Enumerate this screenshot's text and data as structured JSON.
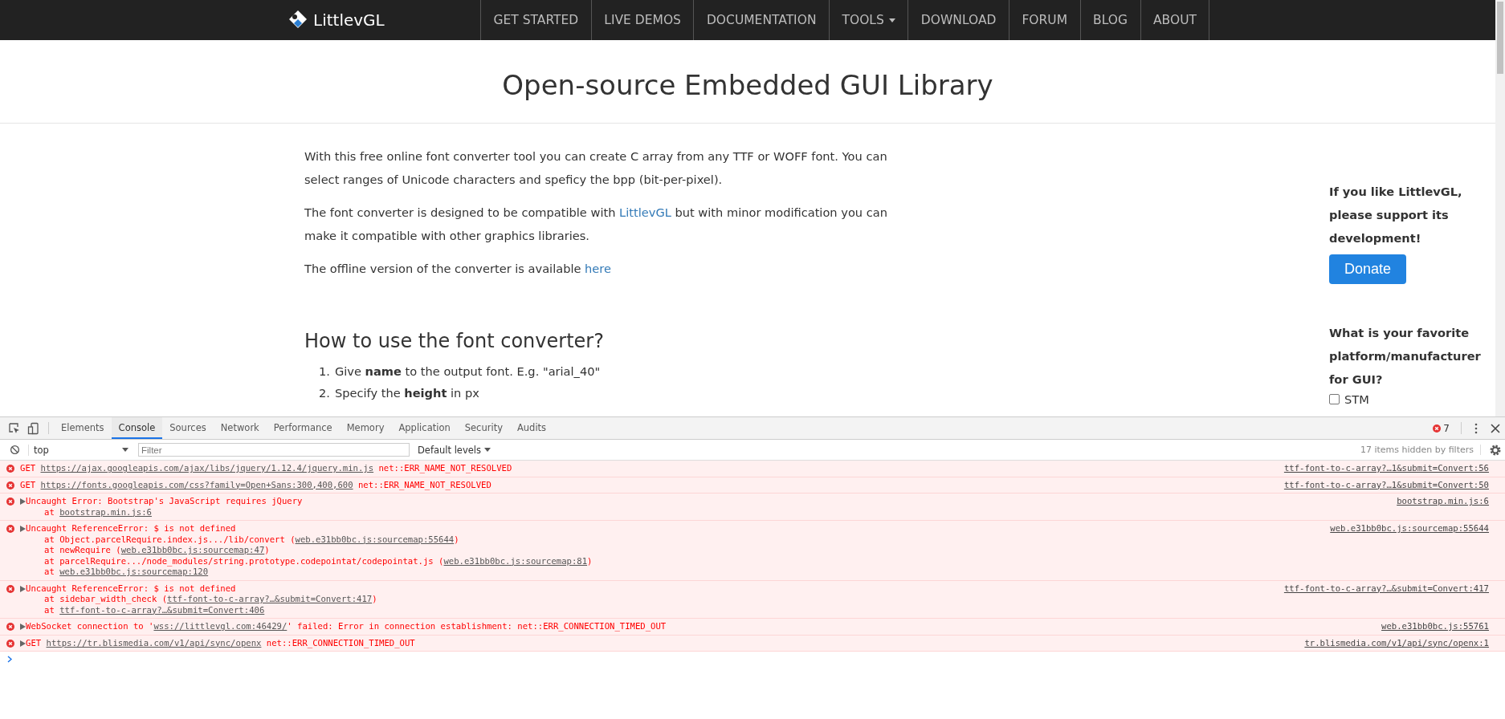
{
  "navbar": {
    "logo": "LittlevGL",
    "items": [
      {
        "label": "GET STARTED",
        "kind": "link"
      },
      {
        "label": "LIVE DEMOS",
        "kind": "link"
      },
      {
        "label": "DOCUMENTATION",
        "kind": "link"
      },
      {
        "label": "TOOLS",
        "kind": "dropdown"
      },
      {
        "label": "DOWNLOAD",
        "kind": "link"
      },
      {
        "label": "FORUM",
        "kind": "link"
      },
      {
        "label": "BLOG",
        "kind": "link"
      },
      {
        "label": "ABOUT",
        "kind": "link"
      }
    ]
  },
  "page": {
    "title": "Open-source Embedded GUI Library",
    "paragraphs": [
      [
        {
          "kind": "text",
          "text": "With this free online font converter tool you can create C array from any TTF or WOFF font. You can select ranges of Unicode characters and speficy the bpp (bit-per-pixel)."
        }
      ],
      [
        {
          "kind": "text",
          "text": "The font converter is designed to be compatible with "
        },
        {
          "kind": "link",
          "text": "LittlevGL"
        },
        {
          "kind": "text",
          "text": " but with minor modification you can make it compatible with other graphics libraries."
        }
      ],
      [
        {
          "kind": "text",
          "text": "The offline version of the converter is available "
        },
        {
          "kind": "link",
          "text": "here"
        }
      ]
    ],
    "section_heading": "How to use the font converter?",
    "steps": [
      {
        "number": "1.",
        "text": "Give **name** to the output font. E.g. \"arial_40\""
      },
      {
        "number": "2.",
        "text": "Specify the **height** in px"
      }
    ]
  },
  "sidebar": {
    "support_text": "If you like LittlevGL, please support its development!",
    "donate_button": "Donate",
    "poll_question": "What is your favorite platform/manufacturer for GUI?",
    "options": [
      {
        "label": "STM",
        "checked": false
      }
    ]
  },
  "devtools": {
    "tabs": [
      {
        "label": "Elements",
        "selected": false
      },
      {
        "label": "Console",
        "selected": true
      },
      {
        "label": "Sources",
        "selected": false
      },
      {
        "label": "Network",
        "selected": false
      },
      {
        "label": "Performance",
        "selected": false
      },
      {
        "label": "Memory",
        "selected": false
      },
      {
        "label": "Application",
        "selected": false
      },
      {
        "label": "Security",
        "selected": false
      },
      {
        "label": "Audits",
        "selected": false
      }
    ],
    "error_count": "7",
    "context": "top",
    "filter_placeholder": "Filter",
    "levels": "Default levels",
    "hidden_note": "17 items hidden by filters",
    "messages": [
      {
        "expandable": false,
        "lines": [
          [
            {
              "kind": "text",
              "text": "GET "
            },
            {
              "kind": "link",
              "text": "https://ajax.googleapis.com/ajax/libs/jquery/1.12.4/jquery.min.js"
            },
            {
              "kind": "text",
              "text": " net::ERR_NAME_NOT_RESOLVED"
            }
          ]
        ],
        "source": "ttf-font-to-c-array?…1&submit=Convert:56"
      },
      {
        "expandable": false,
        "lines": [
          [
            {
              "kind": "text",
              "text": "GET "
            },
            {
              "kind": "link",
              "text": "https://fonts.googleapis.com/css?family=Open+Sans:300,400,600"
            },
            {
              "kind": "text",
              "text": " net::ERR_NAME_NOT_RESOLVED"
            }
          ]
        ],
        "source": "ttf-font-to-c-array?…1&submit=Convert:50"
      },
      {
        "expandable": true,
        "lines": [
          [
            {
              "kind": "text",
              "text": "Uncaught Error: Bootstrap's JavaScript requires jQuery"
            }
          ],
          [
            {
              "kind": "text",
              "text": "at "
            },
            {
              "kind": "link",
              "text": "bootstrap.min.js:6"
            }
          ]
        ],
        "source": "bootstrap.min.js:6"
      },
      {
        "expandable": true,
        "lines": [
          [
            {
              "kind": "text",
              "text": "Uncaught ReferenceError: $ is not defined"
            }
          ],
          [
            {
              "kind": "text",
              "text": "at Object.parcelRequire.index.js.../lib/convert ("
            },
            {
              "kind": "link",
              "text": "web.e31bb0bc.js:sourcemap:55644"
            },
            {
              "kind": "text",
              "text": ")"
            }
          ],
          [
            {
              "kind": "text",
              "text": "at newRequire ("
            },
            {
              "kind": "link",
              "text": "web.e31bb0bc.js:sourcemap:47"
            },
            {
              "kind": "text",
              "text": ")"
            }
          ],
          [
            {
              "kind": "text",
              "text": "at parcelRequire.../node_modules/string.prototype.codepointat/codepointat.js ("
            },
            {
              "kind": "link",
              "text": "web.e31bb0bc.js:sourcemap:81"
            },
            {
              "kind": "text",
              "text": ")"
            }
          ],
          [
            {
              "kind": "text",
              "text": "at "
            },
            {
              "kind": "link",
              "text": "web.e31bb0bc.js:sourcemap:120"
            }
          ]
        ],
        "source": "web.e31bb0bc.js:sourcemap:55644"
      },
      {
        "expandable": true,
        "lines": [
          [
            {
              "kind": "text",
              "text": "Uncaught ReferenceError: $ is not defined"
            }
          ],
          [
            {
              "kind": "text",
              "text": "at sidebar_width_check ("
            },
            {
              "kind": "link",
              "text": "ttf-font-to-c-array?…&submit=Convert:417"
            },
            {
              "kind": "text",
              "text": ")"
            }
          ],
          [
            {
              "kind": "text",
              "text": "at "
            },
            {
              "kind": "link",
              "text": "ttf-font-to-c-array?…&submit=Convert:406"
            }
          ]
        ],
        "source": "ttf-font-to-c-array?…&submit=Convert:417"
      },
      {
        "expandable": true,
        "lines": [
          [
            {
              "kind": "text",
              "text": "WebSocket connection to '"
            },
            {
              "kind": "link",
              "text": "wss://littlevgl.com:46429/"
            },
            {
              "kind": "text",
              "text": "' failed: Error in connection establishment: net::ERR_CONNECTION_TIMED_OUT"
            }
          ]
        ],
        "source": "web.e31bb0bc.js:55761"
      },
      {
        "expandable": true,
        "lines": [
          [
            {
              "kind": "text",
              "text": "GET "
            },
            {
              "kind": "link",
              "text": "https://tr.blismedia.com/v1/api/sync/openx"
            },
            {
              "kind": "text",
              "text": " net::ERR_CONNECTION_TIMED_OUT"
            }
          ]
        ],
        "source": "tr.blismedia.com/v1/api/sync/openx:1"
      }
    ]
  }
}
